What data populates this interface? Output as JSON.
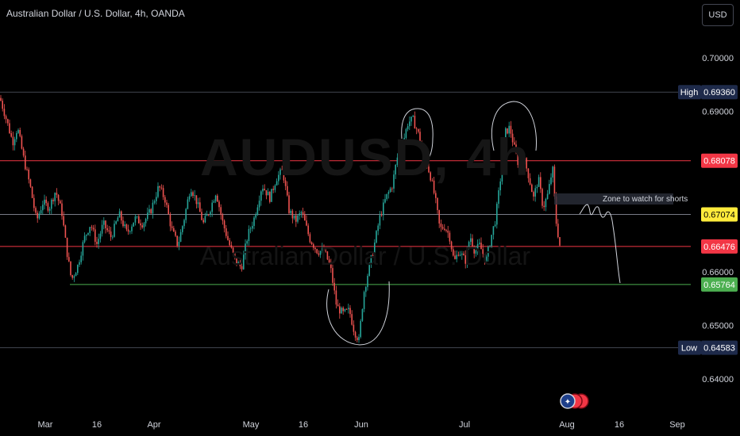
{
  "header": {
    "title": "Australian Dollar / U.S. Dollar, 4h, OANDA",
    "currency_button": "USD"
  },
  "watermark": {
    "symbol": "AUDUSD, 4h",
    "name": "Australian Dollar / U.S. Dollar"
  },
  "colors": {
    "background": "#000000",
    "up": "#26a69a",
    "down": "#ef5350",
    "resistance_line": "#f23645",
    "zone_line": "#d1d4dc",
    "support_line": "#4caf50",
    "high_low_label": "#1e2a4a"
  },
  "annotation": {
    "text": "Zone to watch for shorts"
  },
  "chart_data": {
    "type": "candlestick",
    "title": "Australian Dollar / U.S. Dollar, 4h, OANDA",
    "ylim": [
      0.6375,
      0.705
    ],
    "y_ticks": [
      "0.70000",
      "0.69000",
      "0.66000",
      "0.65000",
      "0.64000"
    ],
    "x_ticks": [
      "Mar",
      "16",
      "Apr",
      "May",
      "16",
      "Jun",
      "Jul",
      "Aug",
      "16",
      "Sep"
    ],
    "price_labels": [
      {
        "label": "High",
        "value": "0.69360",
        "style": "high"
      },
      {
        "label": "",
        "value": "0.68078",
        "style": "red"
      },
      {
        "label": "",
        "value": "0.67074",
        "style": "yellow"
      },
      {
        "label": "",
        "value": "0.66476",
        "style": "red"
      },
      {
        "label": "",
        "value": "0.65764",
        "style": "green"
      },
      {
        "label": "Low",
        "value": "0.64583",
        "style": "low"
      }
    ],
    "horizontal_lines": [
      {
        "value": 0.6936,
        "color": "#434651"
      },
      {
        "value": 0.68078,
        "color": "#f23645"
      },
      {
        "value": 0.67074,
        "color": "#787b86"
      },
      {
        "value": 0.66476,
        "color": "#f23645"
      },
      {
        "value": 0.65764,
        "color": "#4caf50"
      },
      {
        "value": 0.64583,
        "color": "#434651"
      }
    ],
    "price_path": [
      [
        0,
        0.6925
      ],
      [
        8,
        0.6885
      ],
      [
        16,
        0.6842
      ],
      [
        22,
        0.687
      ],
      [
        30,
        0.681
      ],
      [
        38,
        0.676
      ],
      [
        46,
        0.6695
      ],
      [
        54,
        0.673
      ],
      [
        62,
        0.672
      ],
      [
        70,
        0.6752
      ],
      [
        78,
        0.671
      ],
      [
        84,
        0.664
      ],
      [
        90,
        0.6585
      ],
      [
        98,
        0.6612
      ],
      [
        106,
        0.6662
      ],
      [
        114,
        0.669
      ],
      [
        122,
        0.6652
      ],
      [
        130,
        0.669
      ],
      [
        140,
        0.6665
      ],
      [
        150,
        0.6708
      ],
      [
        160,
        0.6672
      ],
      [
        170,
        0.67
      ],
      [
        180,
        0.669
      ],
      [
        190,
        0.6715
      ],
      [
        200,
        0.676
      ],
      [
        208,
        0.6735
      ],
      [
        216,
        0.668
      ],
      [
        224,
        0.665
      ],
      [
        232,
        0.67
      ],
      [
        240,
        0.676
      ],
      [
        248,
        0.673
      ],
      [
        256,
        0.669
      ],
      [
        264,
        0.6715
      ],
      [
        272,
        0.675
      ],
      [
        280,
        0.6695
      ],
      [
        288,
        0.6655
      ],
      [
        296,
        0.6622
      ],
      [
        304,
        0.6608
      ],
      [
        312,
        0.6668
      ],
      [
        320,
        0.67
      ],
      [
        330,
        0.6762
      ],
      [
        340,
        0.6738
      ],
      [
        348,
        0.6775
      ],
      [
        356,
        0.679
      ],
      [
        364,
        0.6715
      ],
      [
        372,
        0.6695
      ],
      [
        380,
        0.6712
      ],
      [
        390,
        0.6662
      ],
      [
        400,
        0.6638
      ],
      [
        408,
        0.664
      ],
      [
        416,
        0.661
      ],
      [
        424,
        0.6535
      ],
      [
        432,
        0.6522
      ],
      [
        440,
        0.6528
      ],
      [
        446,
        0.649
      ],
      [
        452,
        0.6472
      ],
      [
        458,
        0.656
      ],
      [
        464,
        0.6602
      ],
      [
        470,
        0.664
      ],
      [
        478,
        0.67
      ],
      [
        486,
        0.6738
      ],
      [
        494,
        0.6762
      ],
      [
        500,
        0.6812
      ],
      [
        508,
        0.6845
      ],
      [
        514,
        0.688
      ],
      [
        520,
        0.6885
      ],
      [
        526,
        0.6862
      ],
      [
        534,
        0.682
      ],
      [
        542,
        0.678
      ],
      [
        548,
        0.6738
      ],
      [
        554,
        0.668
      ],
      [
        560,
        0.6685
      ],
      [
        566,
        0.6668
      ],
      [
        572,
        0.6618
      ],
      [
        578,
        0.664
      ],
      [
        586,
        0.662
      ],
      [
        592,
        0.6668
      ],
      [
        598,
        0.6638
      ],
      [
        604,
        0.665
      ],
      [
        612,
        0.662
      ],
      [
        618,
        0.6662
      ],
      [
        624,
        0.6698
      ],
      [
        630,
        0.677
      ],
      [
        636,
        0.686
      ],
      [
        642,
        0.687
      ],
      [
        648,
        0.683
      ],
      [
        654,
        0.6795
      ],
      [
        660,
        0.6812
      ],
      [
        666,
        0.6778
      ],
      [
        672,
        0.6738
      ],
      [
        678,
        0.6775
      ],
      [
        684,
        0.672
      ],
      [
        690,
        0.6745
      ],
      [
        696,
        0.6795
      ],
      [
        700,
        0.6698
      ],
      [
        706,
        0.664
      ]
    ]
  }
}
